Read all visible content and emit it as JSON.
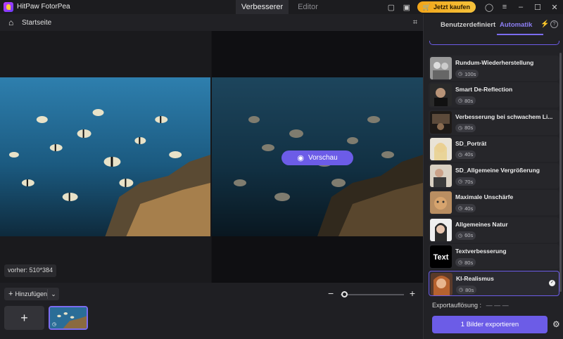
{
  "app": {
    "title": "HitPaw FotorPea",
    "mode_tabs": [
      "Verbesserer",
      "Editor"
    ],
    "buy_label": "Jetzt kaufen"
  },
  "toolbar": {
    "home_label": "Startseite"
  },
  "canvas": {
    "preview_label": "Vorschau",
    "size_label": "vorher: 510*384"
  },
  "bottom": {
    "add_label": "Hinzufügen"
  },
  "panel": {
    "tabs": [
      "Benutzerdefiniert",
      "Automatik"
    ],
    "models": [
      {
        "name": "Rundum-Wiederherstellung",
        "time": "100s"
      },
      {
        "name": "Smart De-Reflection",
        "time": "80s"
      },
      {
        "name": "Verbesserung bei schwachem Li...",
        "time": "80s"
      },
      {
        "name": "SD_Porträt",
        "time": "40s"
      },
      {
        "name": "SD_Allgemeine Vergrößerung",
        "time": "70s"
      },
      {
        "name": "Maximale Unschärfe",
        "time": "40s"
      },
      {
        "name": "Allgemeines Natur",
        "time": "60s"
      },
      {
        "name": "Textverbesserung",
        "time": "80s"
      },
      {
        "name": "KI-Realismus",
        "time": "80s"
      }
    ],
    "text_thumb_label": "Text",
    "export_resolution_label": "Exportauflösung :",
    "export_resolution_value": "— — —",
    "export_button": "1 Bilder exportieren"
  },
  "colors": {
    "accent": "#6c5ce7",
    "buy": "#f5b730"
  }
}
